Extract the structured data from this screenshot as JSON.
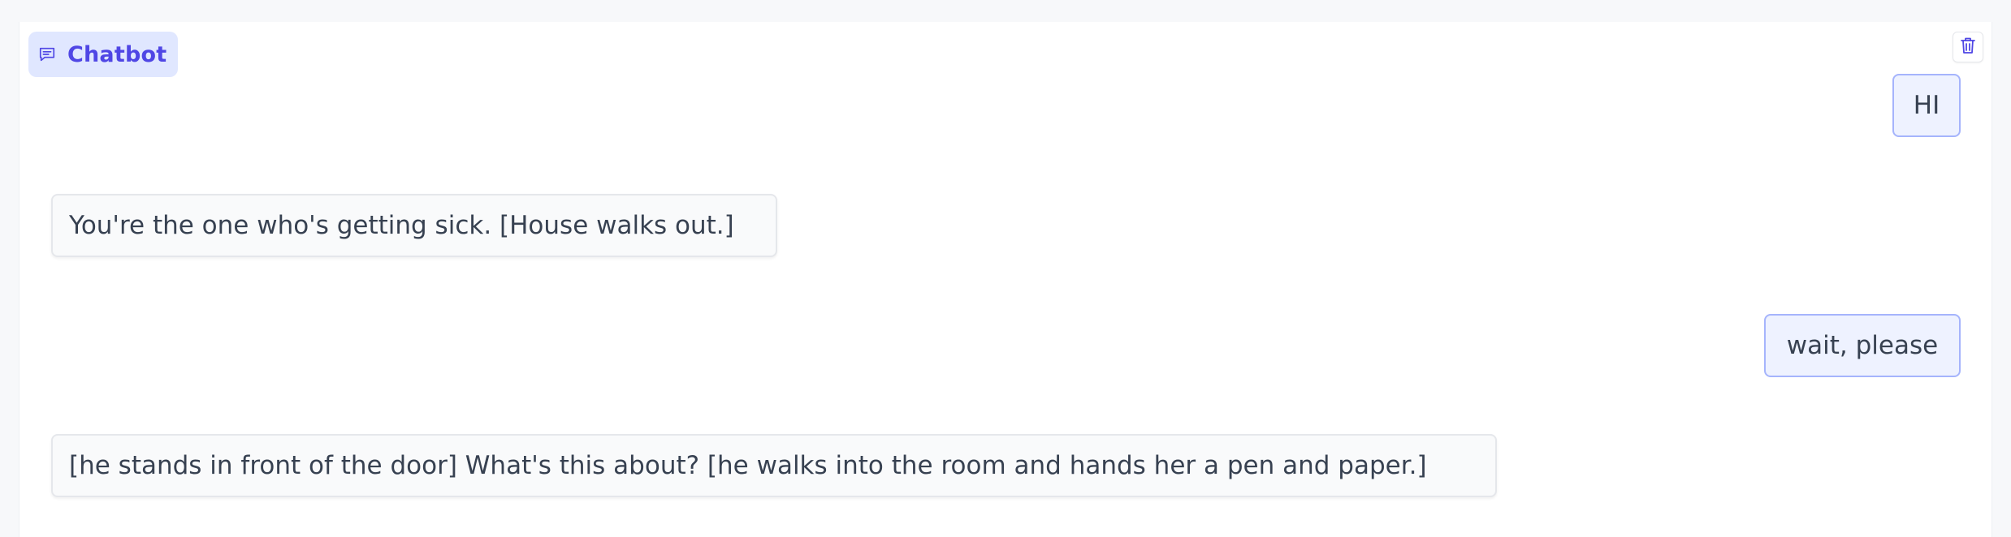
{
  "chatbot": {
    "label": "Chatbot",
    "label_icon": "chat-bubble-icon",
    "clear_icon": "trash-icon",
    "accent_color": "#4f46e5",
    "messages": [
      {
        "role": "user",
        "text": "HI"
      },
      {
        "role": "bot",
        "text": "You're the one who's getting sick. [House walks out.]"
      },
      {
        "role": "user",
        "text": "wait, please"
      },
      {
        "role": "bot",
        "text": "[he stands in front of the door] What's this about? [he walks into the room and hands her a pen and paper.]"
      }
    ]
  }
}
